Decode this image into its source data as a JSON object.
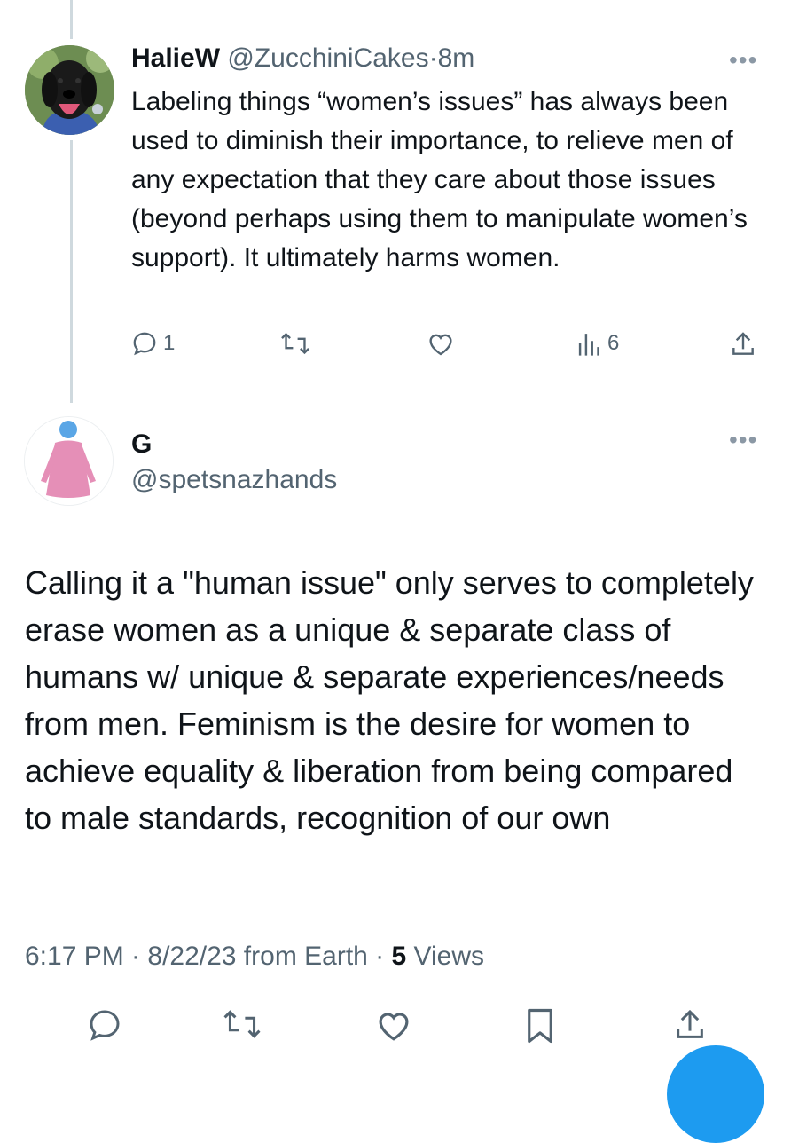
{
  "tweet1": {
    "display_name": "HalieW",
    "handle": "@ZucchiniCakes",
    "separator": "·",
    "time": "8m",
    "text": "Labeling things “women’s issues” has always been used to diminish their importance, to relieve men of any expectation that they care about those issues (beyond perhaps using them to manipulate women’s support). It ultimately harms women.",
    "avatar": "dog-photo",
    "actions": {
      "reply_count": "1",
      "retweet_count": "",
      "like_count": "",
      "views_count": "6"
    }
  },
  "tweet2": {
    "display_name": "G",
    "handle": "@spetsnazhands",
    "avatar": "pink-person-figure",
    "text": "Calling it a \"human issue\" only serves to completely erase women as a unique & separate class of humans w/ unique & separate experiences/needs from men. Feminism is the desire for women to achieve equality & liberation from being compared to male standards, recognition of our own",
    "meta_time": "6:17 PM · 8/22/23 from Earth · ",
    "views_number": "5",
    "views_label": " Views"
  },
  "icons": [
    "reply-icon",
    "retweet-icon",
    "like-icon",
    "views-icon",
    "share-icon",
    "bookmark-icon",
    "more-icon"
  ],
  "colors": {
    "accent": "#1d9bf0",
    "muted": "#536471",
    "text": "#0f1419",
    "thread_line": "#cfd9de",
    "avatar_pink": "#e58fb7",
    "avatar_head_blue": "#5aa6e6"
  }
}
